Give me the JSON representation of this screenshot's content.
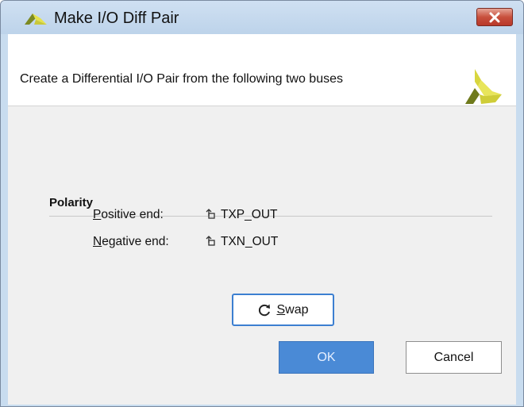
{
  "window": {
    "title": "Make I/O Diff Pair",
    "close_icon": "close-icon"
  },
  "header": {
    "description": "Create a Differential I/O Pair from the following two buses",
    "logo_icon": "vivado-logo-icon"
  },
  "polarity": {
    "section_title": "Polarity",
    "positive": {
      "label_mnemonic": "P",
      "label_rest": "ositive end:",
      "value": "TXP_OUT",
      "icon": "output-port-icon"
    },
    "negative": {
      "label_mnemonic": "N",
      "label_rest": "egative end:",
      "value": "TXN_OUT",
      "icon": "output-port-icon"
    }
  },
  "buttons": {
    "swap_mnemonic": "S",
    "swap_rest": "wap",
    "swap_icon": "refresh-icon",
    "ok": "OK",
    "cancel": "Cancel"
  },
  "colors": {
    "titlebar": "#bdd3ea",
    "close_button": "#c8503d",
    "ok_button": "#4a8ad6",
    "swap_focus_border": "#3c7fd1",
    "logo_dark": "#6f7a1c",
    "logo_light": "#e3e04a"
  }
}
